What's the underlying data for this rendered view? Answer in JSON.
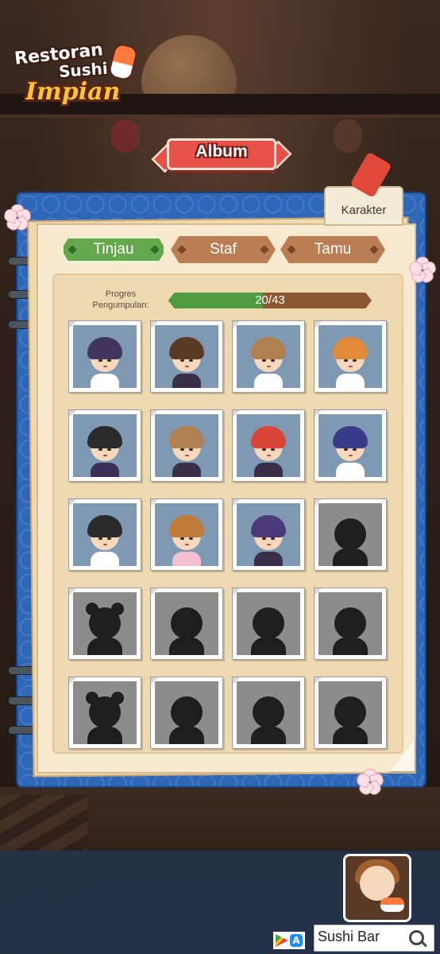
{
  "logo": {
    "line1": "Restoran",
    "line2": "Sushi",
    "line3": "Impian"
  },
  "title": "Album",
  "book_tab": "Karakter",
  "categories": [
    {
      "label": "Tinjau",
      "active": true
    },
    {
      "label": "Staf",
      "active": false
    },
    {
      "label": "Tamu",
      "active": false
    }
  ],
  "progress": {
    "label_line1": "Progres",
    "label_line2": "Pengumpulan:",
    "text": "20/43",
    "collected": 20,
    "total": 43
  },
  "characters": [
    {
      "unlocked": true,
      "hair": "#3f3560",
      "outfit": "#ffffff"
    },
    {
      "unlocked": true,
      "hair": "#5a3a24",
      "outfit": "#3a2f48"
    },
    {
      "unlocked": true,
      "hair": "#b08050",
      "outfit": "#ffffff"
    },
    {
      "unlocked": true,
      "hair": "#e08a3a",
      "outfit": "#ffffff"
    },
    {
      "unlocked": true,
      "hair": "#2a2a2a",
      "outfit": "#3a2f58"
    },
    {
      "unlocked": true,
      "hair": "#b08050",
      "outfit": "#3a2f48"
    },
    {
      "unlocked": true,
      "hair": "#d8463a",
      "outfit": "#3a2f48"
    },
    {
      "unlocked": true,
      "hair": "#3a3a8a",
      "outfit": "#ffffff"
    },
    {
      "unlocked": true,
      "hair": "#2a2a2a",
      "outfit": "#ffffff"
    },
    {
      "unlocked": true,
      "hair": "#c07a3a",
      "outfit": "#f4bfd0"
    },
    {
      "unlocked": true,
      "hair": "#4a3a7a",
      "outfit": "#3a2f48"
    },
    {
      "unlocked": false
    },
    {
      "unlocked": false
    },
    {
      "unlocked": false
    },
    {
      "unlocked": false
    },
    {
      "unlocked": false
    },
    {
      "unlocked": false
    },
    {
      "unlocked": false
    },
    {
      "unlocked": false
    },
    {
      "unlocked": false
    }
  ],
  "search": {
    "text": "Sushi Bar"
  },
  "icons": {
    "search": "search-icon",
    "google_play": "google-play-icon",
    "app_store": "app-store-icon"
  },
  "colors": {
    "book_blue": "#2f67b8",
    "tab_active": "#64a74d",
    "tab_inactive": "#bb7d54",
    "progress_fill": "#4f9a3f",
    "progress_track": "#8b5632",
    "title_red": "#e8504a"
  }
}
